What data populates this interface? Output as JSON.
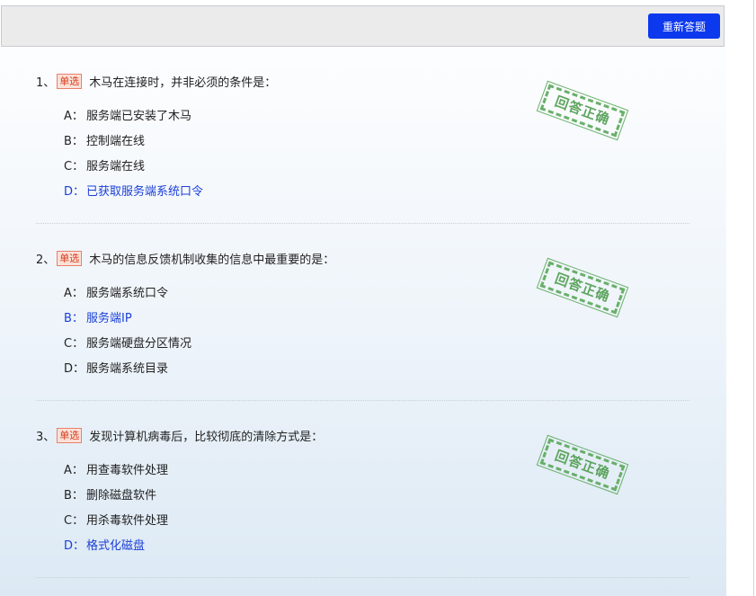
{
  "toolbar": {
    "redo_label": "重新答题"
  },
  "questions": [
    {
      "number": "1、",
      "type": "单选",
      "text": "木马在连接时，并非必须的条件是：",
      "stamp": "回答正确",
      "options": [
        {
          "letter": "A：",
          "text": "服务端已安装了木马",
          "correct": false
        },
        {
          "letter": "B：",
          "text": "控制端在线",
          "correct": false
        },
        {
          "letter": "C：",
          "text": "服务端在线",
          "correct": false
        },
        {
          "letter": "D：",
          "text": "已获取服务端系统口令",
          "correct": true
        }
      ]
    },
    {
      "number": "2、",
      "type": "单选",
      "text": "木马的信息反馈机制收集的信息中最重要的是：",
      "stamp": "回答正确",
      "options": [
        {
          "letter": "A：",
          "text": "服务端系统口令",
          "correct": false
        },
        {
          "letter": "B：",
          "text": "服务端IP",
          "correct": true
        },
        {
          "letter": "C：",
          "text": "服务端硬盘分区情况",
          "correct": false
        },
        {
          "letter": "D：",
          "text": "服务端系统目录",
          "correct": false
        }
      ]
    },
    {
      "number": "3、",
      "type": "单选",
      "text": "发现计算机病毒后，比较彻底的清除方式是：",
      "stamp": "回答正确",
      "options": [
        {
          "letter": "A：",
          "text": "用查毒软件处理",
          "correct": false
        },
        {
          "letter": "B：",
          "text": "删除磁盘软件",
          "correct": false
        },
        {
          "letter": "C：",
          "text": "用杀毒软件处理",
          "correct": false
        },
        {
          "letter": "D：",
          "text": "格式化磁盘",
          "correct": true
        }
      ]
    }
  ],
  "colors": {
    "accent": "#0c38ee",
    "correct_text": "#1a3fd8",
    "stamp": "#4f9c4f",
    "badge": "#d63c1c"
  }
}
